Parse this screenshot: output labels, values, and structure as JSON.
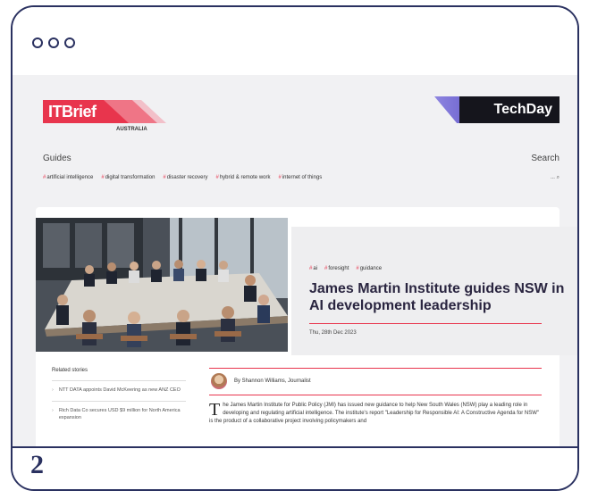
{
  "step": {
    "number": "2"
  },
  "header": {
    "itbrief": {
      "brand": "ITBrief",
      "country": "AUSTRALIA"
    },
    "techday": {
      "brand": "TechDay"
    }
  },
  "nav": {
    "guides": "Guides",
    "search": "Search"
  },
  "tags": [
    "artificial intelligence",
    "digital transformation",
    "disaster recovery",
    "hybrid & remote work",
    "internet of things"
  ],
  "search_ctrl": "...  ⌕",
  "article": {
    "tags": [
      "ai",
      "foresight",
      "guidance"
    ],
    "title": "James Martin Institute guides NSW in AI development leadership",
    "date": "Thu, 28th Dec 2023",
    "author": "By Shannon Williams, Journalist",
    "body": "he James Martin Institute for Public Policy (JMI) has issued new guidance to help New South Wales (NSW) play a leading role in developing and regulating artificial intelligence. The institute's report \"Leadership for Responsible AI: A Constructive Agenda for NSW\" is the product of a collaborative project involving policymakers and",
    "dropcap": "T"
  },
  "related": {
    "title": "Related stories",
    "items": [
      "NTT DATA appoints David McKeering as new ANZ CEO",
      "Rich Data Co secures USD $9 million for North America expansion"
    ]
  },
  "colors": {
    "accent": "#e8354d",
    "frame": "#2a3160",
    "techday_accent": "#6f63d6"
  }
}
